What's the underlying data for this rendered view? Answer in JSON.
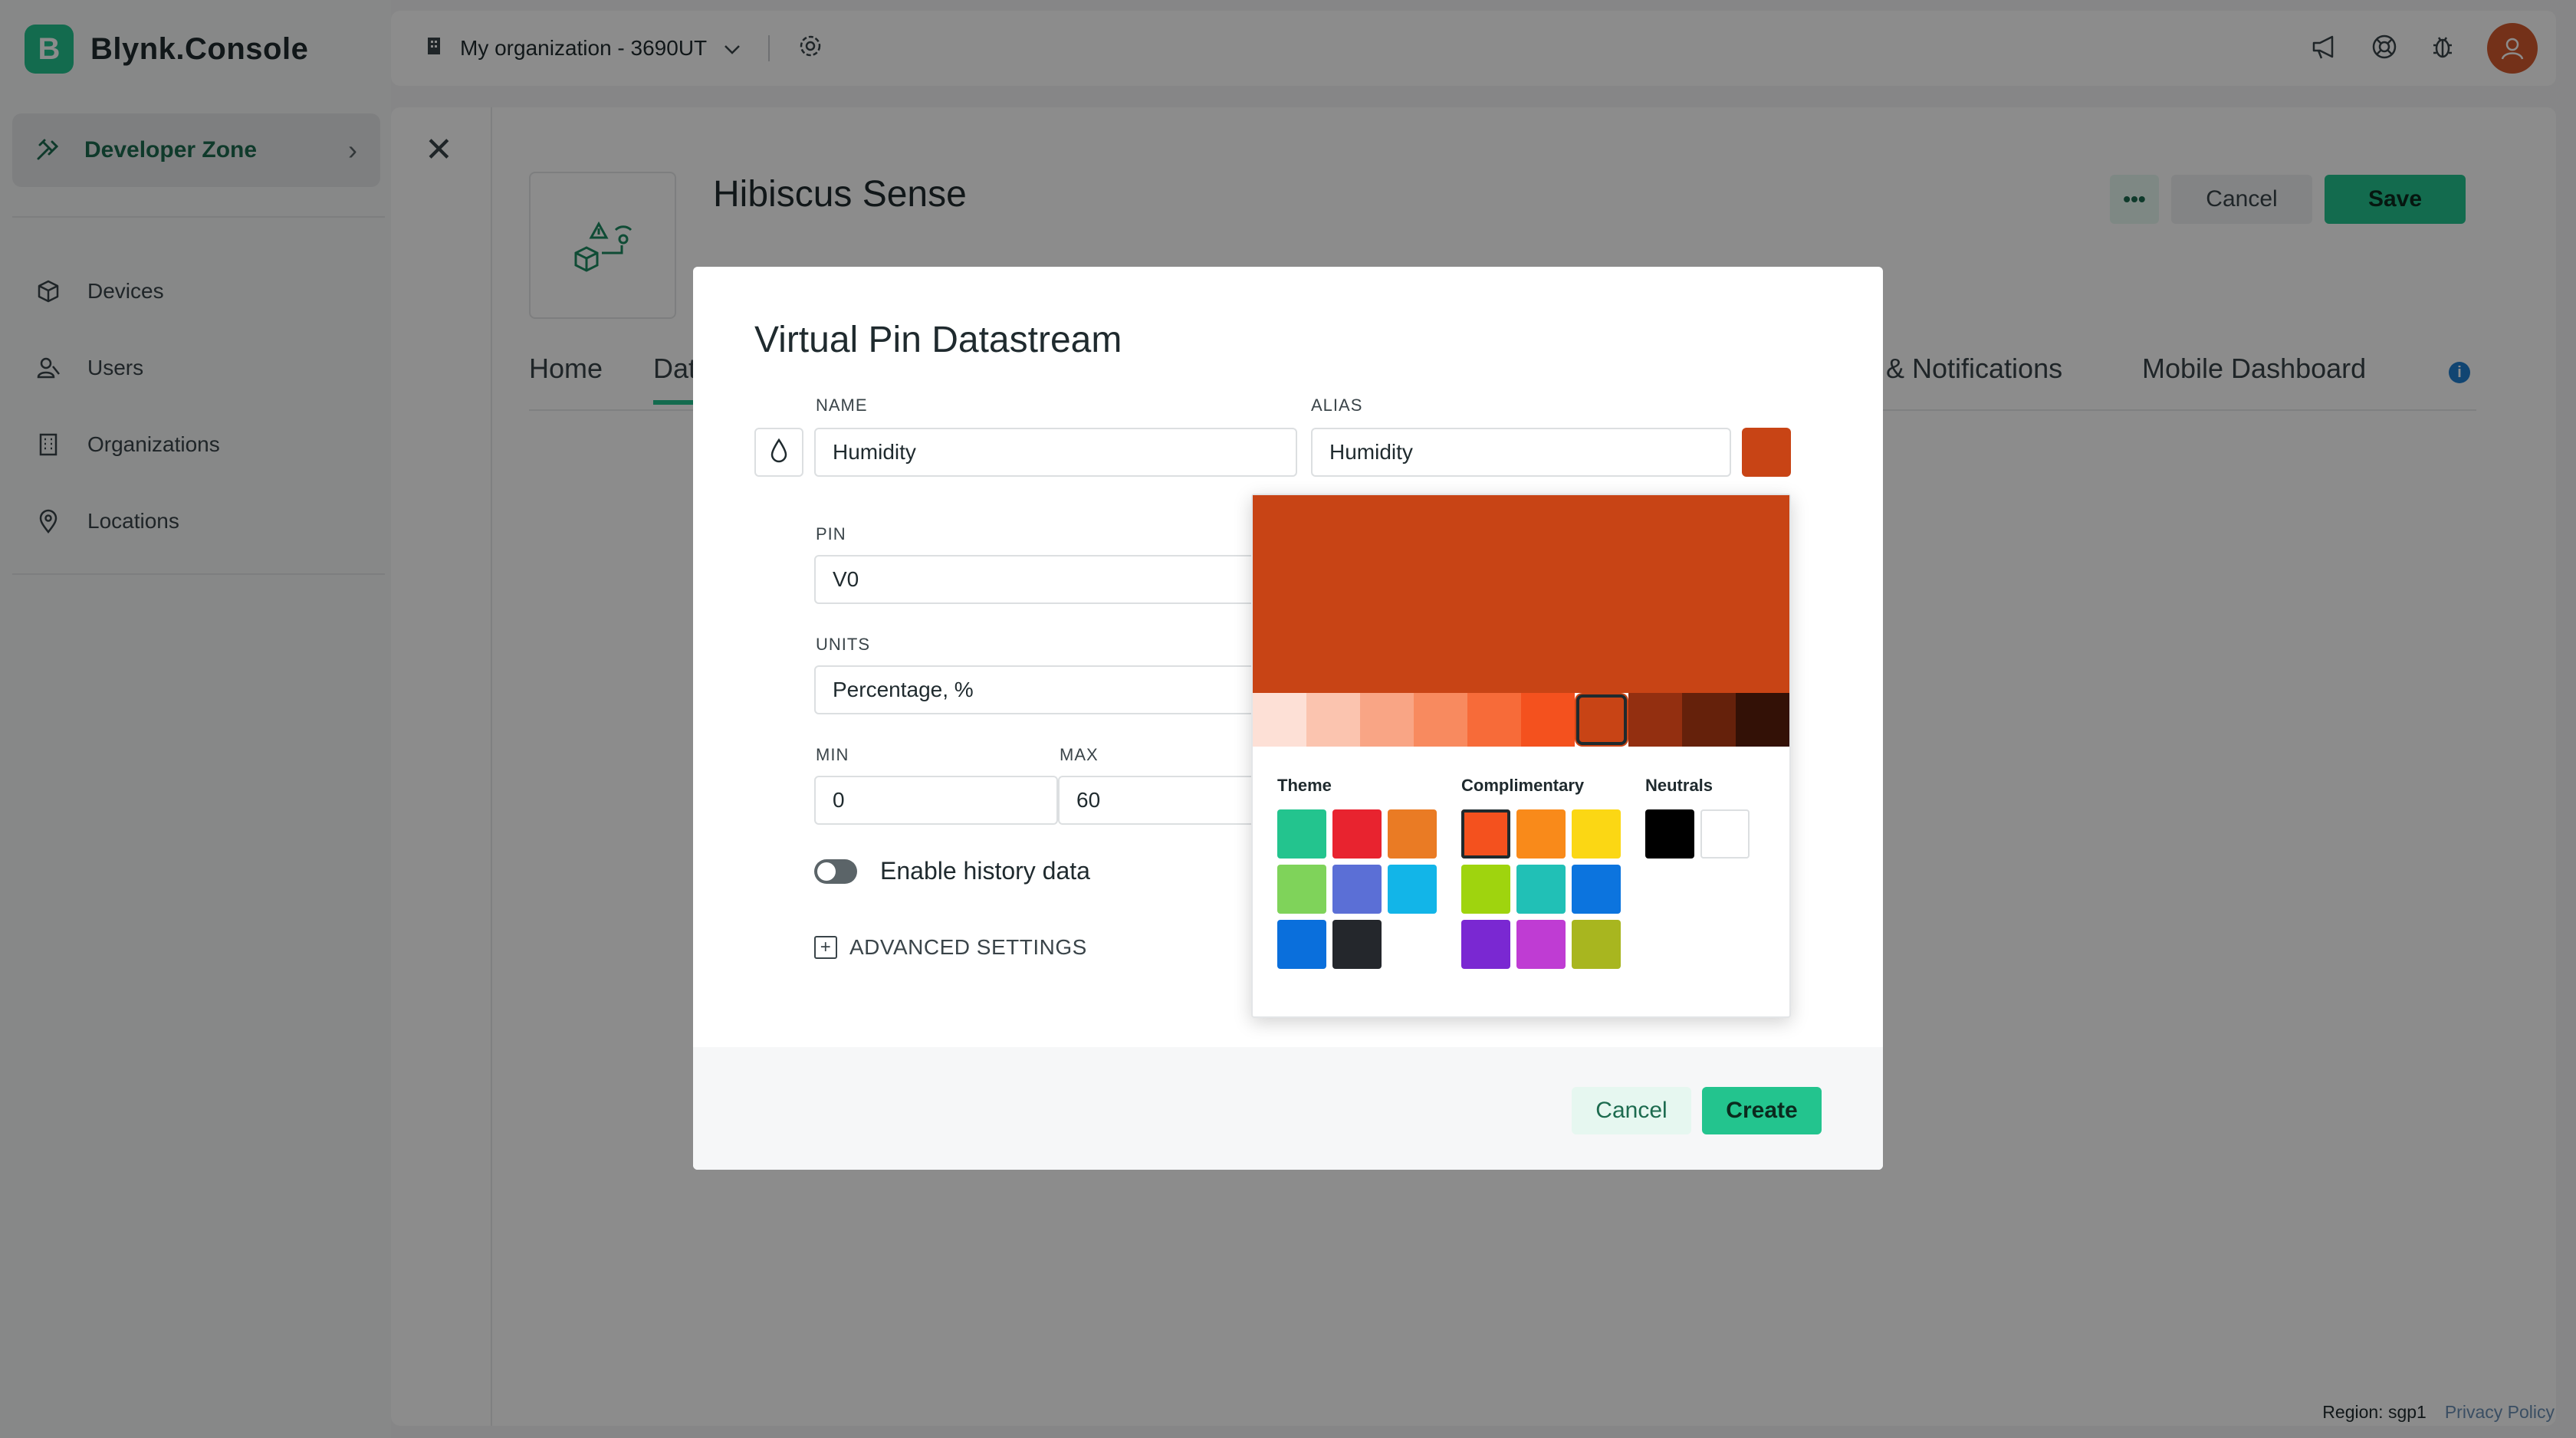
{
  "app": {
    "logo_letter": "B",
    "name": "Blynk.Console"
  },
  "sidebar": {
    "developer_zone": "Developer Zone",
    "items": [
      {
        "label": "Devices",
        "icon": "cube-icon"
      },
      {
        "label": "Users",
        "icon": "users-icon"
      },
      {
        "label": "Organizations",
        "icon": "building-icon"
      },
      {
        "label": "Locations",
        "icon": "map-pin-icon"
      }
    ]
  },
  "topbar": {
    "organization": "My organization - 3690UT",
    "icons": [
      "megaphone-icon",
      "help-lifebuoy-icon",
      "bug-icon",
      "avatar"
    ]
  },
  "template": {
    "title": "Hibiscus Sense",
    "more_label": "•••",
    "cancel_label": "Cancel",
    "save_label": "Save",
    "tabs": {
      "home": "Home",
      "datastreams_partial": "Dat",
      "notifications_partial": "& Notifications",
      "mobile_dashboard": "Mobile Dashboard",
      "info": "i"
    }
  },
  "modal": {
    "title": "Virtual Pin Datastream",
    "name_label": "NAME",
    "name_value": "Humidity",
    "alias_label": "ALIAS",
    "alias_value": "Humidity",
    "pin_label": "PIN",
    "pin_value": "V0",
    "units_label": "UNITS",
    "units_value": "Percentage, %",
    "min_label": "MIN",
    "min_value": "0",
    "max_label": "MAX",
    "max_value": "60",
    "history_label": "Enable history data",
    "history_enabled": false,
    "advanced_label": "ADVANCED SETTINGS",
    "cancel_label": "Cancel",
    "create_label": "Create",
    "selected_color": "#c84415"
  },
  "color_picker": {
    "preview_color": "#c84415",
    "shades": [
      "#fde0d6",
      "#fbc4af",
      "#f9a585",
      "#f88a5f",
      "#f76b39",
      "#f4511e",
      "#c84415",
      "#932f10",
      "#65210b",
      "#331106"
    ],
    "selected_shade_index": 6,
    "theme_label": "Theme",
    "theme": [
      "#23c48e",
      "#e8232f",
      "#ea7b24",
      "#7fd35a",
      "#5b6fd6",
      "#12b5e8",
      "#0a6fdc",
      "#24272c"
    ],
    "complimentary_label": "Complimentary",
    "complimentary": [
      "#f4511e",
      "#f98a1a",
      "#fbd714",
      "#9fd40e",
      "#21c0b6",
      "#0c74de",
      "#7a28d2",
      "#bf3cd3",
      "#a8b61f"
    ],
    "selected_complimentary_index": 0,
    "neutrals_label": "Neutrals",
    "neutrals": [
      "#000000",
      "#ffffff"
    ]
  },
  "footer": {
    "region": "Region: sgp1",
    "privacy": "Privacy Policy"
  }
}
